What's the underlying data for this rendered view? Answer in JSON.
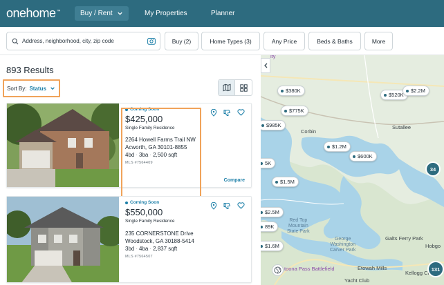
{
  "nav": {
    "logo": "onehome",
    "logo_tm": "™",
    "buy_rent": "Buy / Rent",
    "my_properties": "My Properties",
    "planner": "Planner"
  },
  "filters": {
    "search_placeholder": "Address, neighborhood, city, zip code",
    "buy": "Buy (2)",
    "home_types": "Home Types (3)",
    "price": "Any Price",
    "beds_baths": "Beds & Baths",
    "more": "More"
  },
  "results": {
    "count": "893 Results",
    "sort_label": "Sort By:",
    "sort_value": "Status",
    "compare_label": "Compare",
    "listings": [
      {
        "status": "Coming Soon",
        "price": "$425,000",
        "type": "Single Family Residence",
        "address1": "2264 Howell Farms Trail NW",
        "address2": "Acworth, GA 30101-8855",
        "beds": "4bd",
        "baths": "3ba",
        "sqft": "2,500 sqft",
        "mls": "MLS #7564409"
      },
      {
        "status": "Coming Soon",
        "price": "$550,000",
        "type": "Single Family Residence",
        "address1": "235 CORNERSTONE Drive",
        "address2": "Woodstock, GA 30188-5414",
        "beds": "3bd",
        "baths": "4ba",
        "sqft": "2,837 sqft",
        "mls": "MLS #7564507"
      }
    ]
  },
  "map": {
    "pins": [
      "$380K",
      "$520K",
      "$2.2M",
      "$775K",
      "$985K",
      "$1.2M",
      "$600K",
      "$1.5M",
      "$2.5M",
      "89K",
      "$1.6M",
      "5K"
    ],
    "clusters": [
      "34",
      "131"
    ],
    "labels": {
      "corbin": "Corbin",
      "sutallee": "Sutallee",
      "red_top": "Red Top\nMountain\nState Park",
      "george_washington": "George\nWashington\nCarver Park",
      "galts_ferry": "Galts Ferry Park",
      "etowah": "Etowah Mills",
      "kellogg": "Kellogg Cree",
      "yacht": "Yacht Club",
      "allatoona": "toona Pass Battlefield",
      "hobgo": "Hobgo",
      "city_top": "ity"
    }
  }
}
